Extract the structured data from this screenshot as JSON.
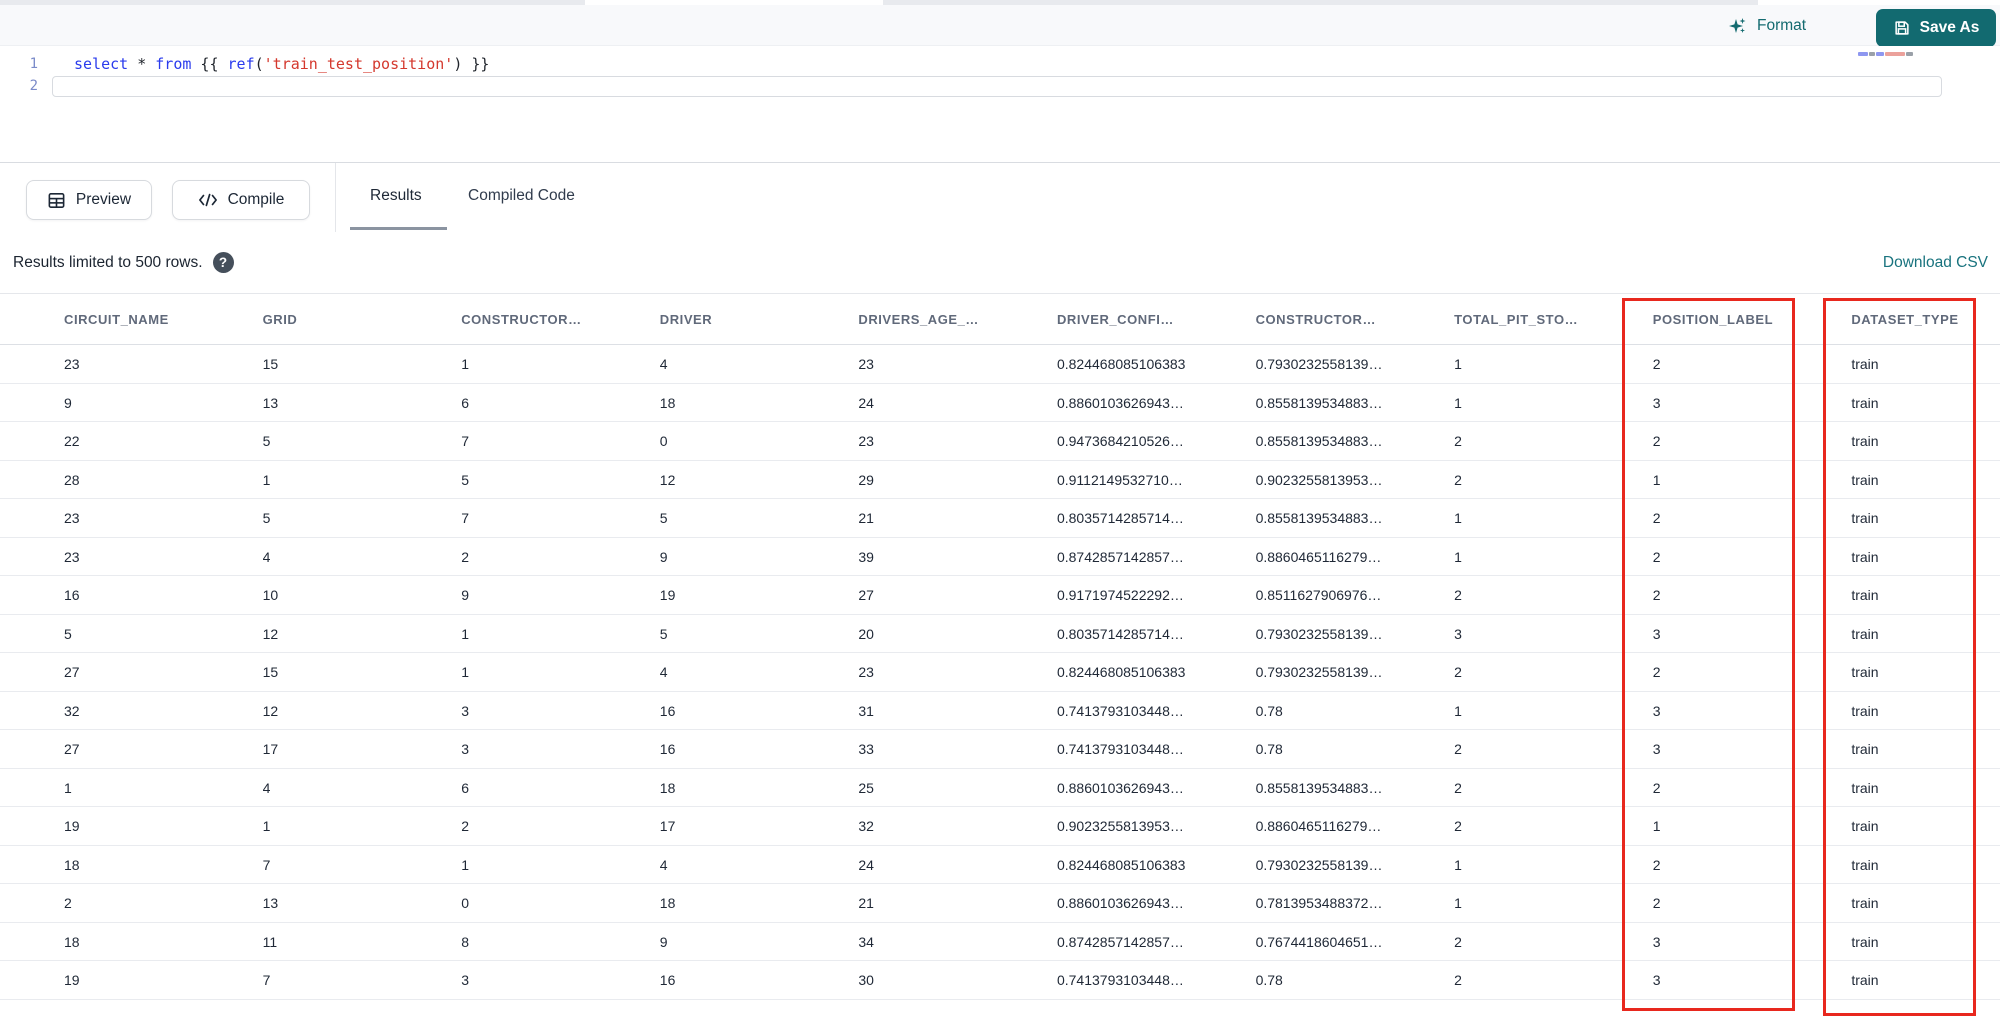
{
  "toolbar": {
    "format_label": "Format",
    "save_as_label": "Save As"
  },
  "editor": {
    "lines": [
      {
        "number": "1",
        "cursor": false,
        "tokens": [
          {
            "type": "keyword",
            "text": "select"
          },
          {
            "type": "plain",
            "text": " * "
          },
          {
            "type": "keyword",
            "text": "from"
          },
          {
            "type": "plain",
            "text": " {{ "
          },
          {
            "type": "keyword",
            "text": "ref"
          },
          {
            "type": "plain",
            "text": "("
          },
          {
            "type": "string",
            "text": "'train_test_position'"
          },
          {
            "type": "plain",
            "text": ") }}"
          }
        ]
      },
      {
        "number": "2",
        "cursor": true,
        "tokens": []
      }
    ]
  },
  "actions": {
    "preview_label": "Preview",
    "compile_label": "Compile"
  },
  "tabs": {
    "results_label": "Results",
    "compiled_code_label": "Compiled Code",
    "active_tab": "Results"
  },
  "results_bar": {
    "info_text": "Results limited to 500 rows.",
    "help_glyph": "?",
    "download_label": "Download CSV"
  },
  "table": {
    "columns": [
      "CIRCUIT_NAME",
      "GRID",
      "CONSTRUCTOR…",
      "DRIVER",
      "DRIVERS_AGE_…",
      "DRIVER_CONFI…",
      "CONSTRUCTOR…",
      "TOTAL_PIT_STO…",
      "POSITION_LABEL",
      "DATASET_TYPE"
    ],
    "rows": [
      [
        "23",
        "15",
        "1",
        "4",
        "23",
        "0.824468085106383",
        "0.7930232558139…",
        "1",
        "2",
        "train"
      ],
      [
        "9",
        "13",
        "6",
        "18",
        "24",
        "0.8860103626943…",
        "0.8558139534883…",
        "1",
        "3",
        "train"
      ],
      [
        "22",
        "5",
        "7",
        "0",
        "23",
        "0.9473684210526…",
        "0.8558139534883…",
        "2",
        "2",
        "train"
      ],
      [
        "28",
        "1",
        "5",
        "12",
        "29",
        "0.9112149532710…",
        "0.9023255813953…",
        "2",
        "1",
        "train"
      ],
      [
        "23",
        "5",
        "7",
        "5",
        "21",
        "0.8035714285714…",
        "0.8558139534883…",
        "1",
        "2",
        "train"
      ],
      [
        "23",
        "4",
        "2",
        "9",
        "39",
        "0.8742857142857…",
        "0.8860465116279…",
        "1",
        "2",
        "train"
      ],
      [
        "16",
        "10",
        "9",
        "19",
        "27",
        "0.9171974522292…",
        "0.8511627906976…",
        "2",
        "2",
        "train"
      ],
      [
        "5",
        "12",
        "1",
        "5",
        "20",
        "0.8035714285714…",
        "0.7930232558139…",
        "3",
        "3",
        "train"
      ],
      [
        "27",
        "15",
        "1",
        "4",
        "23",
        "0.824468085106383",
        "0.7930232558139…",
        "2",
        "2",
        "train"
      ],
      [
        "32",
        "12",
        "3",
        "16",
        "31",
        "0.7413793103448…",
        "0.78",
        "1",
        "3",
        "train"
      ],
      [
        "27",
        "17",
        "3",
        "16",
        "33",
        "0.7413793103448…",
        "0.78",
        "2",
        "3",
        "train"
      ],
      [
        "1",
        "4",
        "6",
        "18",
        "25",
        "0.8860103626943…",
        "0.8558139534883…",
        "2",
        "2",
        "train"
      ],
      [
        "19",
        "1",
        "2",
        "17",
        "32",
        "0.9023255813953…",
        "0.8860465116279…",
        "2",
        "1",
        "train"
      ],
      [
        "18",
        "7",
        "1",
        "4",
        "24",
        "0.824468085106383",
        "0.7930232558139…",
        "1",
        "2",
        "train"
      ],
      [
        "2",
        "13",
        "0",
        "18",
        "21",
        "0.8860103626943…",
        "0.7813953488372…",
        "1",
        "2",
        "train"
      ],
      [
        "18",
        "11",
        "8",
        "9",
        "34",
        "0.8742857142857…",
        "0.7674418604651…",
        "2",
        "3",
        "train"
      ],
      [
        "19",
        "7",
        "3",
        "16",
        "30",
        "0.7413793103448…",
        "0.78",
        "2",
        "3",
        "train"
      ]
    ]
  },
  "annotations": {
    "highlight_color": "#e8281e",
    "highlighted_columns": [
      "POSITION_LABEL",
      "DATASET_TYPE"
    ]
  },
  "colors": {
    "accent_teal": "#126a70",
    "keyword_blue": "#2a3bed",
    "string_red": "#d4382d",
    "header_grey": "#60697a"
  }
}
